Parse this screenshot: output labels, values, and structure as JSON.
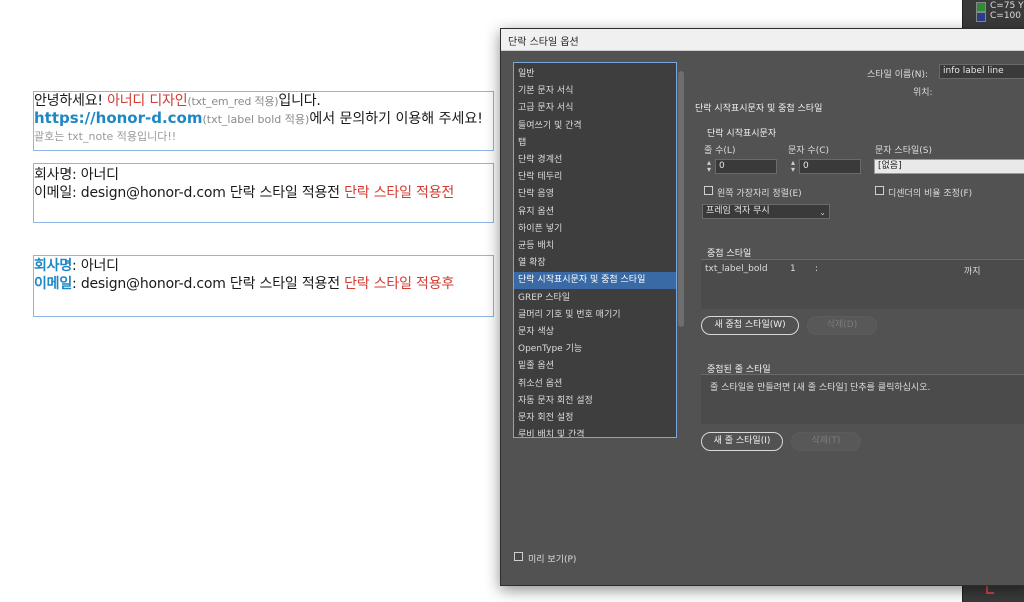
{
  "document": {
    "frame1": {
      "line1": {
        "t1": "안녕하세요! ",
        "t2": "아너디 디자인",
        "t3": "(txt_em_red 적용)",
        "t4": "입니다."
      },
      "line2": {
        "t1": "https://honor-d.com",
        "t2": "(txt_label bold 적용)",
        "t3": "에서 문의하기 이용해 주세요!"
      },
      "line3": "괄호는 txt_note 적용입니다!!"
    },
    "frame2": {
      "line1": "회사명: 아너디",
      "line2": {
        "t1": "이메일: design@honor-d.com 단락 스타일 적용전 ",
        "t2": "단락 스타일 적용전"
      }
    },
    "frame3": {
      "line1": {
        "label": "회사명",
        "rest": ": 아너디"
      },
      "line2": {
        "label": "이메일",
        "rest": ": design@honor-d.com 단락 스타일 적용전 ",
        "red": "단락 스타일 적용후"
      }
    }
  },
  "swatches": [
    {
      "label": "C=75 Y",
      "color": "#2f8a3a"
    },
    {
      "label": "C=100",
      "color": "#2b3d8f"
    }
  ],
  "dialog": {
    "title": "단락 스타일 옵션",
    "categories": [
      "일반",
      "기본 문자 서식",
      "고급 문자 서식",
      "들여쓰기 및 간격",
      "탭",
      "단락 경계선",
      "단락 테두리",
      "단락 음영",
      "유지 옵션",
      "하이픈 넣기",
      "균등 배치",
      "열 확장",
      "단락 시작표시문자 및 중첩 스타일",
      "GREP 스타일",
      "글머리 기호 및 번호 매기기",
      "문자 색상",
      "OpenType 기능",
      "밑줄 옵션",
      "취소선 옵션",
      "자동 문자 회전 설정",
      "문자 회전 설정",
      "루비 배치 및 간격"
    ],
    "selected_category": "단락 시작표시문자 및 중첩 스타일",
    "preview_label": "미리 보기(P)",
    "style_name_label": "스타일 이름(N):",
    "style_name_value": "info label line",
    "location_label": "위치:",
    "section_heading": "단락 시작표시문자 및 중첩 스타일",
    "dropcap": {
      "heading": "단락 시작표시문자",
      "lines_label": "줄 수(L)",
      "lines_value": "0",
      "chars_label": "문자 수(C)",
      "chars_value": "0",
      "char_style_label": "문자 스타일(S)",
      "char_style_value": "[없음]",
      "align_left_label": "왼쪽 가장자리 정렬(E)",
      "descender_label": "디센더의 비율 조정(F)",
      "frame_grid_value": "프레임 격자 무시"
    },
    "nested": {
      "heading": "중첩 스타일",
      "row": {
        "style": "txt_label_bold",
        "count": "1",
        "sep": ":",
        "until": "까지"
      },
      "new_button": "새 중첩 스타일(W)",
      "delete_button": "삭제(D)"
    },
    "nested_line": {
      "heading": "중첩된 줄 스타일",
      "hint": "줄 스타일을 만들려면 [새 줄 스타일] 단추를 클릭하십시오.",
      "new_button": "새 줄 스타일(I)",
      "delete_button": "삭제(T)"
    }
  }
}
